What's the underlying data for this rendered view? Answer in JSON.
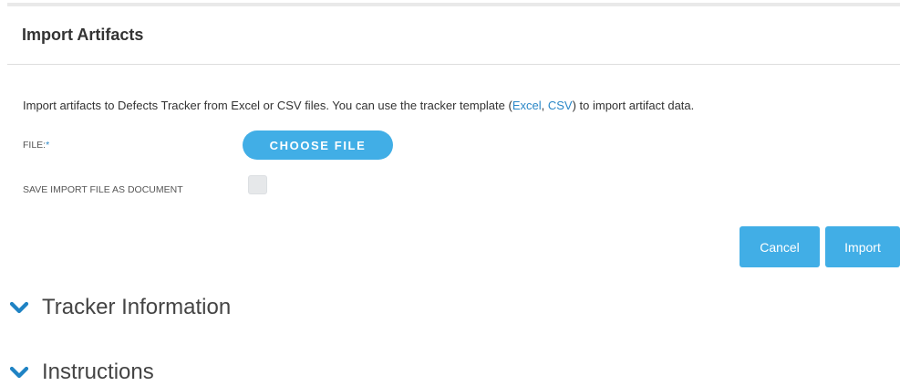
{
  "dialog": {
    "title": "Import Artifacts",
    "description": {
      "before": "Import artifacts to Defects Tracker from Excel or CSV files. You can use the tracker template (",
      "excel_link": "Excel",
      "separator": ", ",
      "csv_link": "CSV",
      "after": ") to import artifact data."
    },
    "file_field": {
      "label": "FILE:",
      "required_mark": "*",
      "button_label": "CHOOSE FILE"
    },
    "save_field": {
      "label": "SAVE IMPORT FILE AS DOCUMENT",
      "checked": false
    },
    "actions": {
      "cancel_label": "Cancel",
      "import_label": "Import"
    }
  },
  "sections": [
    {
      "title": "Tracker Information",
      "icon": "chevron-down-icon"
    },
    {
      "title": "Instructions",
      "icon": "chevron-down-icon"
    }
  ],
  "colors": {
    "accent": "#41aee6",
    "link": "#2a87c7",
    "chevron": "#1f83c4"
  }
}
